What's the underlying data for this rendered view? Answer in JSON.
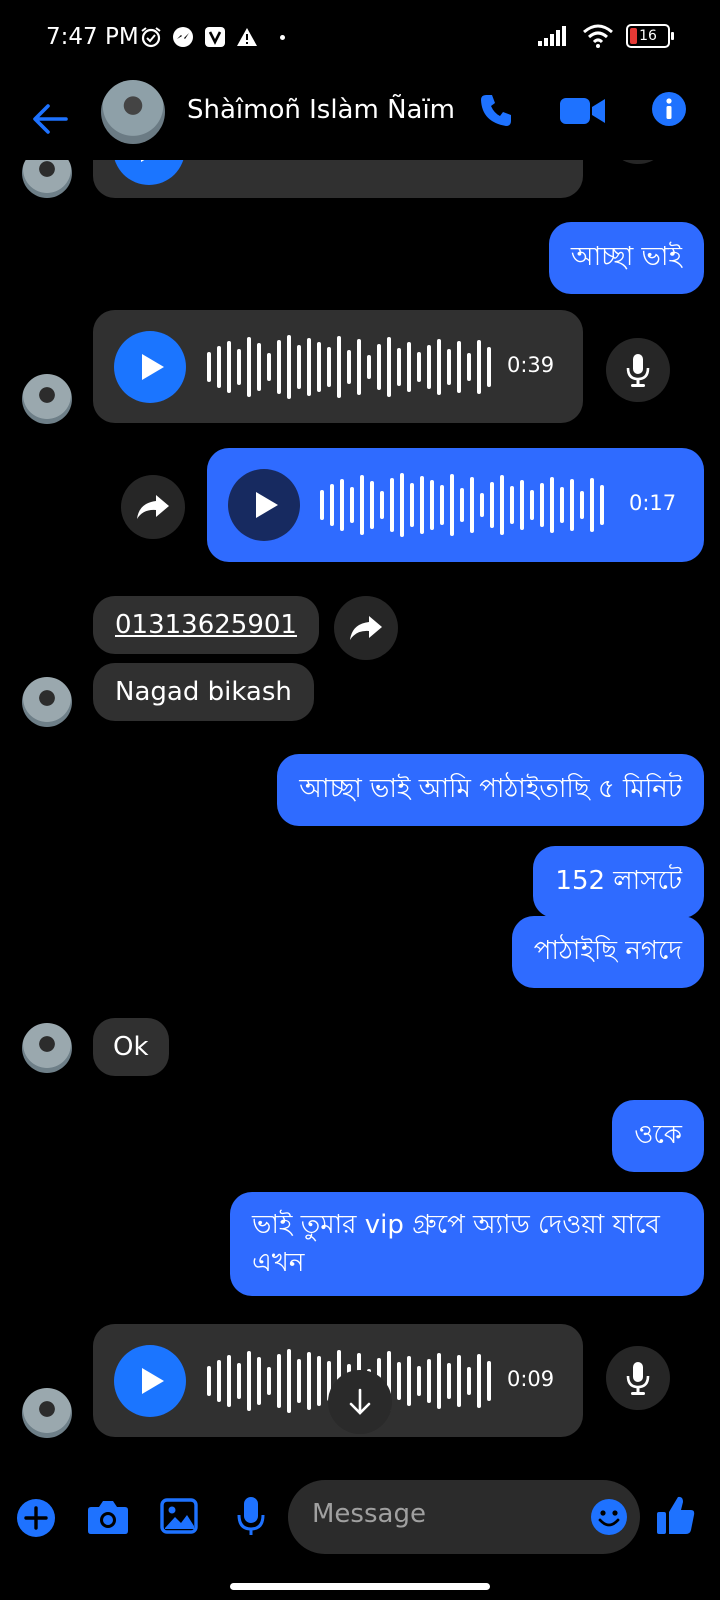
{
  "status_bar": {
    "time": "7:47 PM",
    "battery": "16"
  },
  "header": {
    "contact_name": "Shàîmoñ Islàm Ñaïm"
  },
  "messages": {
    "m1_text": "আচ্ছা ভাই",
    "voice1_duration": "0:39",
    "voice2_duration": "0:17",
    "phone_link": "01313625901",
    "nagad_text": "Nagad bikash",
    "m2_text": "আচ্ছা ভাই আমি পাঠাইতাছি ৫ মিনিট",
    "m3_text": "152 লাসটে",
    "m4_text": "পাঠাইছি নগদে",
    "ok_text": "Ok",
    "m5_text": "ওকে",
    "m6_line1": "ভাই তুমার vip গ্রুপে অ্যাড দেওয়া যাবে",
    "m6_line2": "এখন",
    "voice3_duration": "0:09"
  },
  "composer": {
    "placeholder": "Message"
  },
  "colors": {
    "accent": "#1e72ff",
    "outgoing_bubble": "#2f6bff",
    "incoming_bubble": "#303030"
  }
}
